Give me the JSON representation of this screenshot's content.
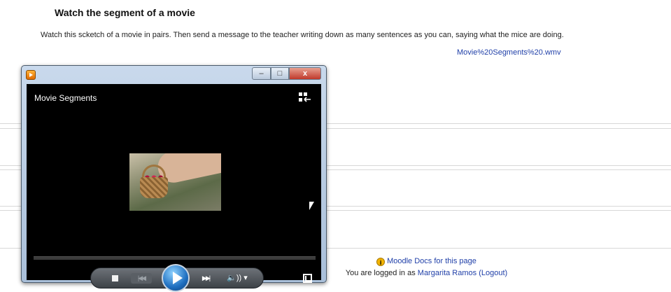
{
  "activity": {
    "title": "Watch the segment of a movie",
    "instructions": "Watch this scketch of a movie in pairs. Then send a message to the teacher writing down as many sentences as you can, saying what the mice are doing.",
    "file_link": "Movie%20Segments%20.wmv"
  },
  "footer": {
    "docs_icon": "info-icon",
    "docs_link": "Moodle Docs for this page",
    "logged_in_prefix": "You are logged in as",
    "user_name": "Margarita Ramos",
    "logout_link": "(Logout)"
  },
  "player": {
    "window_controls": {
      "minimize": "–",
      "maximize": "□",
      "close": "x"
    },
    "video_title": "Movie Segments",
    "icons": {
      "app": "media-player-icon",
      "switch_view": "switch-to-library-icon",
      "stop": "stop-icon",
      "previous": "previous-icon",
      "play": "play-icon",
      "next": "next-icon",
      "volume": "volume-icon",
      "fullscreen": "expand-icon"
    },
    "controls": {
      "previous": "|◀◀",
      "next": "▶▶|",
      "volume": "🔈)) ▾"
    },
    "colors": {
      "video_bg": "#000000",
      "play_button": "#1f6fc0"
    }
  },
  "colors": {
    "link": "#1f3fa8",
    "close_button": "#c0392b"
  }
}
